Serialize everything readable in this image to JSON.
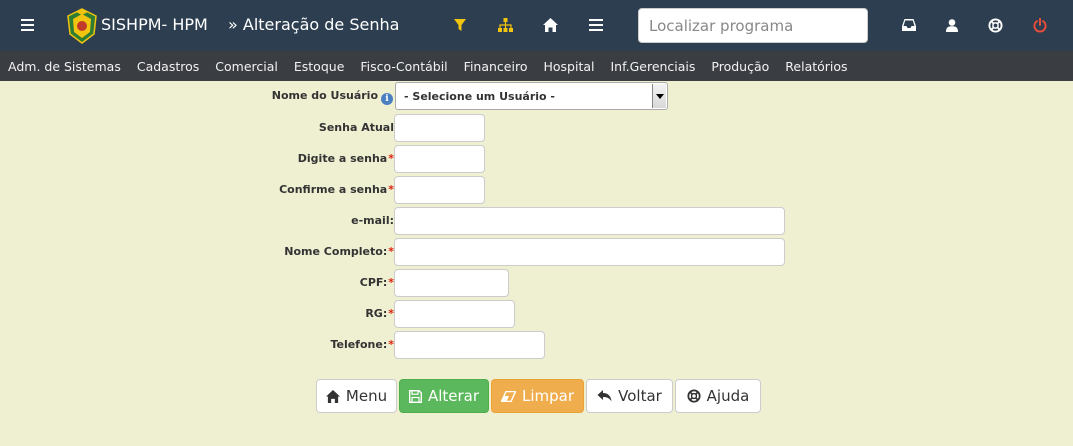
{
  "header": {
    "app_title": "SISHPM- HPM",
    "page_title": "» Alteração de Senha",
    "search_placeholder": "Localizar programa",
    "danger_color": "#e74c3c",
    "warning_color": "#f1c40f"
  },
  "menu": {
    "items": [
      "Adm. de Sistemas",
      "Cadastros",
      "Comercial",
      "Estoque",
      "Fisco-Contábil",
      "Financeiro",
      "Hospital",
      "Inf.Gerenciais",
      "Produção",
      "Relatórios"
    ]
  },
  "form": {
    "usuario_label": "Nome do Usuário",
    "usuario_info": "i",
    "usuario_selected": "- Selecione um Usuário -",
    "senha_atual_label": "Senha Atual",
    "nova_senha_label": "Digite a senha",
    "confirma_label": "Confirme a senha",
    "email_label": "e-mail:",
    "nome_completo_label": "Nome Completo:",
    "cpf_label": "CPF:",
    "rg_label": "RG:",
    "telefone_label": "Telefone:",
    "required_mark": "*"
  },
  "buttons": {
    "menu": "Menu",
    "alterar": "Alterar",
    "limpar": "Limpar",
    "voltar": "Voltar",
    "ajuda": "Ajuda"
  }
}
